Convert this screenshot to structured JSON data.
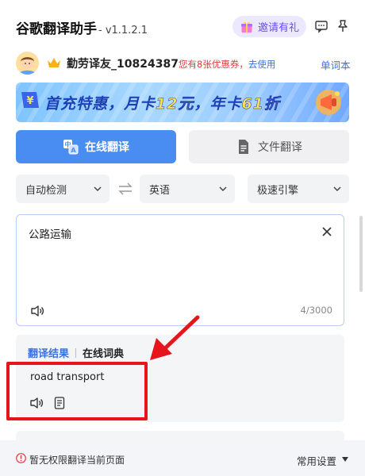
{
  "header": {
    "title": "谷歌翻译助手",
    "version": "- v1.1.2.1",
    "invite_label": "邀请有礼",
    "icons": [
      "gift-icon",
      "message-icon",
      "pin-icon"
    ]
  },
  "user": {
    "name": "勤劳译友_10824387",
    "promo_text": "您有8张优惠券，",
    "promo_link": "去使用",
    "vocab_label": "单词本"
  },
  "banner": {
    "part1": "首充特惠，月卡",
    "price1": "12元",
    "part2": "，年卡",
    "price2": "61折"
  },
  "modes": {
    "online": "在线翻译",
    "file": "文件翻译"
  },
  "languages": {
    "source": "自动检测",
    "target": "英语",
    "engine": "极速引擎"
  },
  "input": {
    "text": "公路运输",
    "count": "4/3000"
  },
  "result": {
    "tab_result": "翻译结果",
    "tab_dict": "在线词典",
    "output": "road transport"
  },
  "footer": {
    "warning": "暂无权限翻译当前页面",
    "settings": "常用设置"
  },
  "colors": {
    "accent": "#4a8df2",
    "link": "#3a72e0",
    "promo": "#e4393c",
    "annotation": "#e8141c"
  }
}
